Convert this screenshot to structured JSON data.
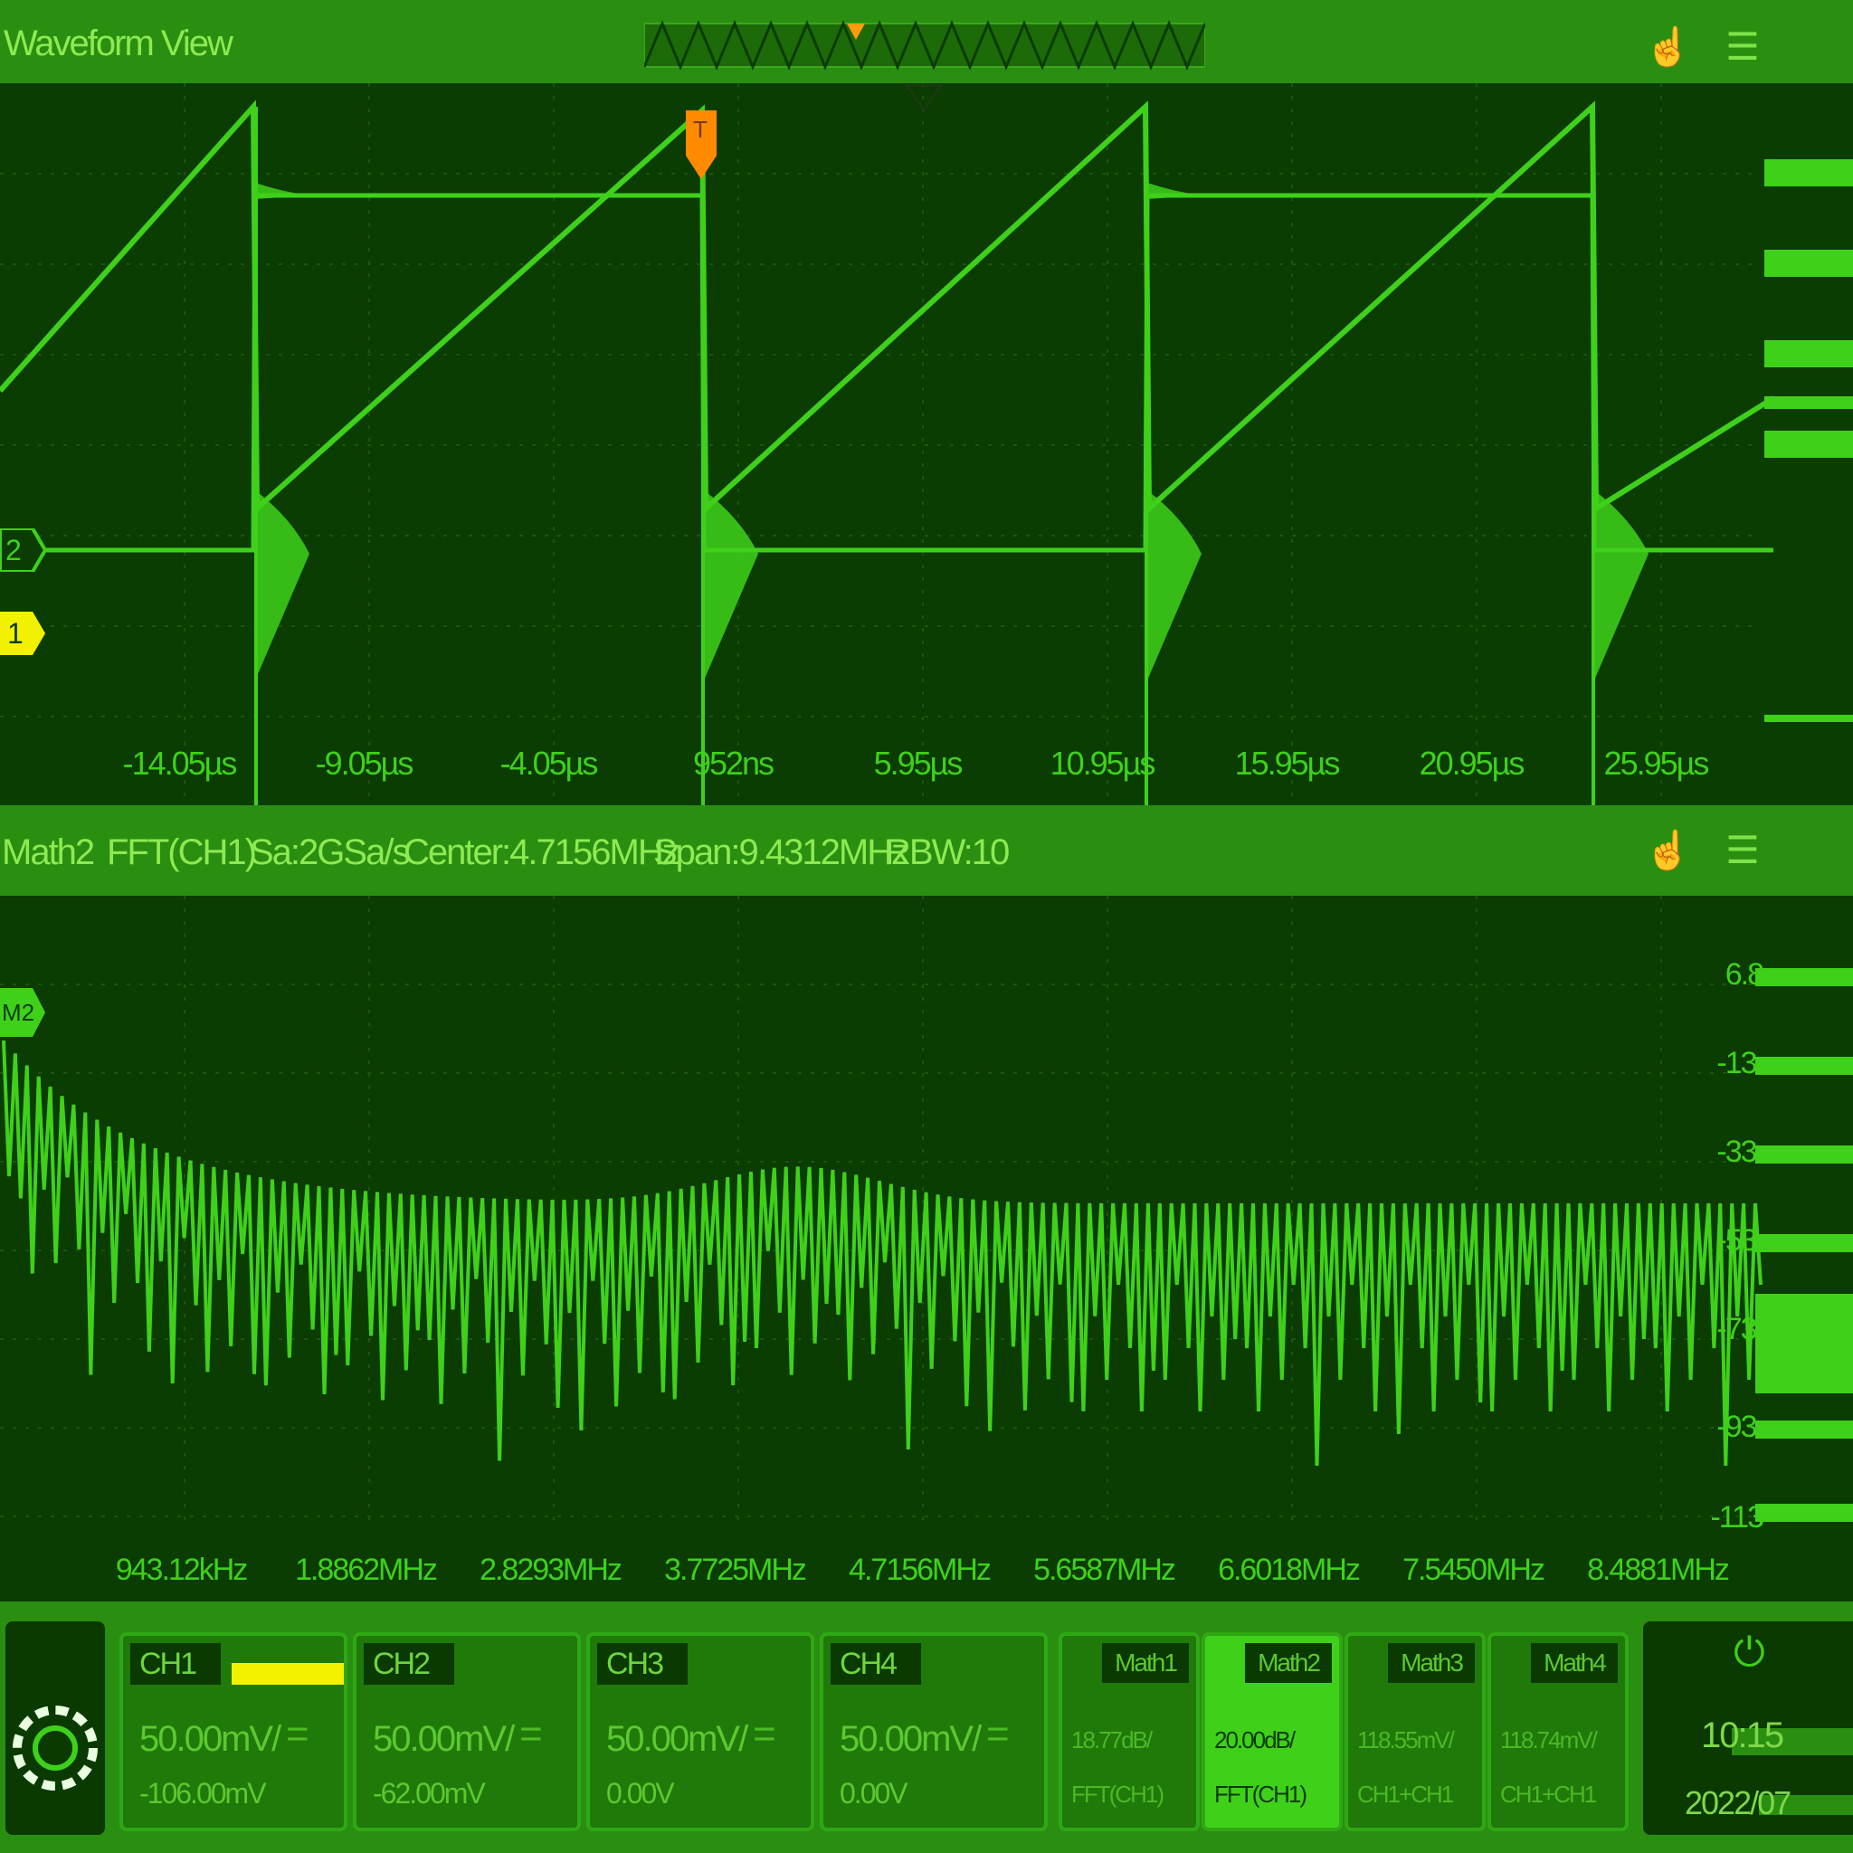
{
  "waveform_view": {
    "title": "Waveform View",
    "time_ticks": [
      "-14.05µs",
      "-9.05µs",
      "-4.05µs",
      "952ns",
      "5.95µs",
      "10.95µs",
      "15.95µs",
      "20.95µs",
      "25.95µs"
    ],
    "channel_markers": {
      "ch2": "2",
      "ch1": "1"
    },
    "trigger_marker": "T"
  },
  "fft_view": {
    "header": {
      "name": "Math2",
      "source": "FFT(CH1)",
      "sample_rate": "Sa:2GSa/s",
      "center": "Center:4.7156MHz",
      "span": "Span:9.4312MHz",
      "rbw": "RBW:10"
    },
    "marker": "M2",
    "freq_ticks": [
      "943.12kHz",
      "1.8862MHz",
      "2.8293MHz",
      "3.7725MHz",
      "4.7156MHz",
      "5.6587MHz",
      "6.6018MHz",
      "7.5450MHz",
      "8.4881MHz"
    ],
    "db_ticks": [
      "6.8",
      "-13.",
      "-33.",
      "-53.",
      "-73.",
      "-93.",
      "-113"
    ]
  },
  "channels": [
    {
      "name": "CH1",
      "scale": "50.00mV/",
      "offset": "-106.00mV",
      "active": true
    },
    {
      "name": "CH2",
      "scale": "50.00mV/",
      "offset": "-62.00mV",
      "active": false
    },
    {
      "name": "CH3",
      "scale": "50.00mV/",
      "offset": "0.00V",
      "active": false
    },
    {
      "name": "CH4",
      "scale": "50.00mV/",
      "offset": "0.00V",
      "active": false
    }
  ],
  "maths": [
    {
      "name": "Math1",
      "value": "18.77dB/",
      "source": "FFT(CH1)",
      "active": false
    },
    {
      "name": "Math2",
      "value": "20.00dB/",
      "source": "FFT(CH1)",
      "active": true
    },
    {
      "name": "Math3",
      "value": "118.55mV/",
      "source": "CH1+CH1",
      "active": false
    },
    {
      "name": "Math4",
      "value": "118.74mV/",
      "source": "CH1+CH1",
      "active": false
    }
  ],
  "status": {
    "time": "10:15",
    "date": "2022/07"
  },
  "icons": {
    "top_settings": "touch-settings-icon",
    "menu": "hamburger-menu-icon",
    "logo": "gear-logo-icon",
    "power": "power-icon"
  },
  "colors": {
    "trace": "#3fd11a",
    "ch1": "#f2f200",
    "trigger": "#ff8a00",
    "panel": "#0b3c02",
    "bar": "#2a8f10"
  }
}
